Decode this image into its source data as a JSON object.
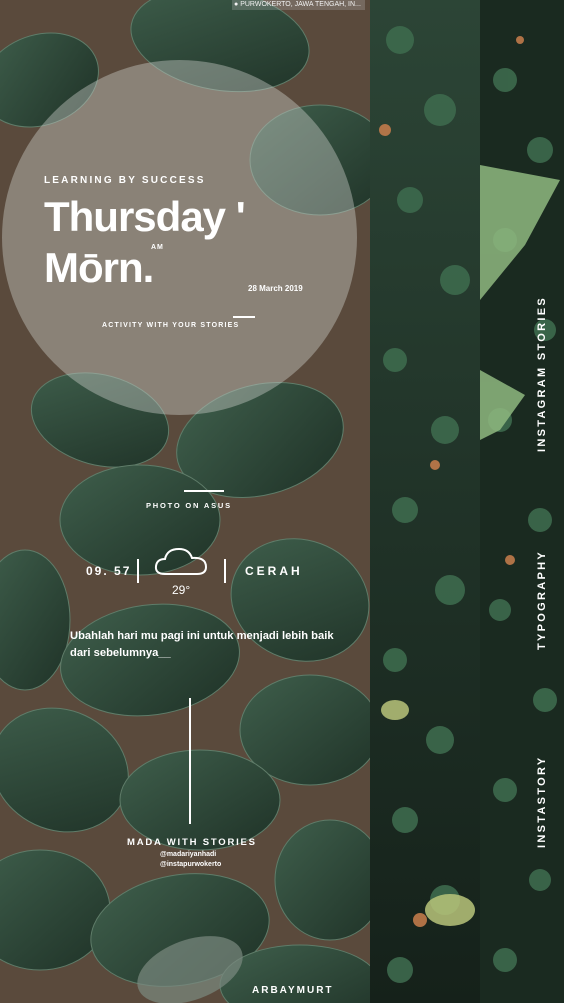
{
  "location": "PURWOKERTO, JAWA TENGAH, IN...",
  "kicker": "LEARNING BY SUCCESS",
  "title_line1": "Thursday '",
  "title_line2": "Mōrn.",
  "am_label": "AM",
  "date": "28 March 2019",
  "activity": "ACTIVITY WITH YOUR STORIES",
  "photo_label": "PHOTO ON ASUS",
  "weather": {
    "time": "09. 57",
    "temperature": "29°",
    "condition": "CERAH"
  },
  "quote": "Ubahlah hari mu pagi ini untuk menjadi lebih baik dari sebelumnya__",
  "credit": {
    "title": "MADA WITH STORIES",
    "handle1": "@madariyanhadi",
    "handle2": "@instapurwokerto"
  },
  "signature": "ARBAYMURT",
  "vertical_labels": [
    "INSTAGRAM STORIES",
    "TYPOGRAPHY",
    "INSTASTORY"
  ],
  "colors": {
    "leaf_dark": "#22352a",
    "leaf_mid": "#3b5a47",
    "stem": "#6b5644",
    "accent_white": "#ffffff"
  },
  "icons": [
    "cloud-icon",
    "location-pin-icon"
  ]
}
